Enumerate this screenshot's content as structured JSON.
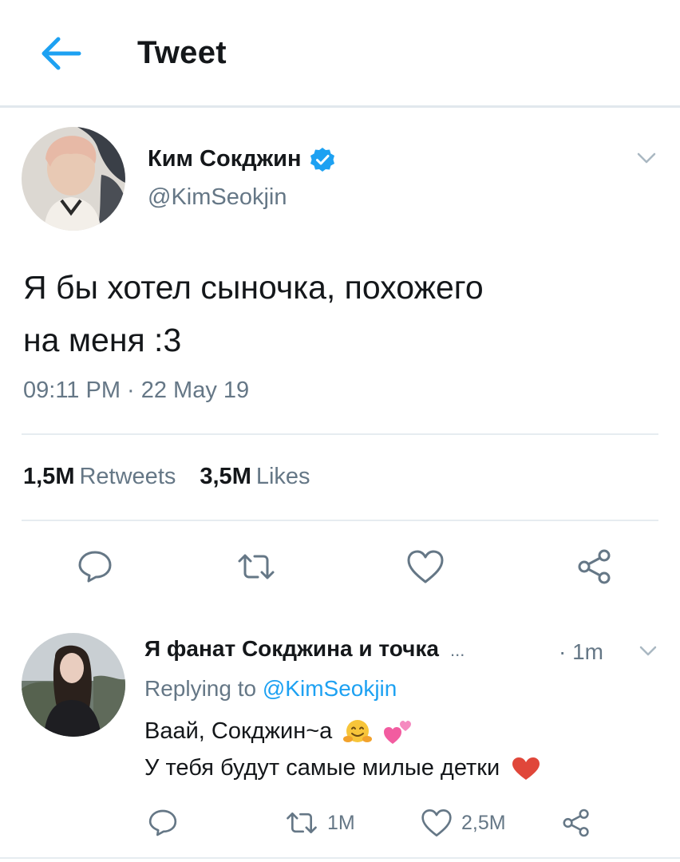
{
  "header": {
    "title": "Tweet"
  },
  "tweet": {
    "author_name": "Ким Сокджин",
    "handle": "@KimSeokjin",
    "text_line1": "Я бы хотел сыночка, похожего",
    "text_line2": "на меня :3",
    "timestamp": "09:11 PM · 22 May 19",
    "retweets_count": "1,5M",
    "retweets_label": "Retweets",
    "likes_count": "3,5M",
    "likes_label": "Likes"
  },
  "reply": {
    "author_name": "Я фанат Сокджина и точка",
    "ellipsis": "...",
    "time": "· 1m",
    "replying_prefix": "Replying to",
    "replying_mention": "@KimSeokjin",
    "text_line1": "Ваай, Сокджин~а",
    "text_line2": "У тебя будут самые милые детки",
    "retweet_count": "1M",
    "like_count": "2,5M"
  },
  "colors": {
    "accent": "#1da1f2",
    "text": "#14171a",
    "secondary": "#657786",
    "divider": "#e6ecf0",
    "heart": "#e0245e"
  },
  "icons": {
    "back": "arrow-left-icon",
    "verified": "verified-badge-icon",
    "caret": "chevron-down-icon",
    "reply": "reply-bubble-icon",
    "retweet": "retweet-icon",
    "like": "heart-icon",
    "share": "share-icon"
  }
}
